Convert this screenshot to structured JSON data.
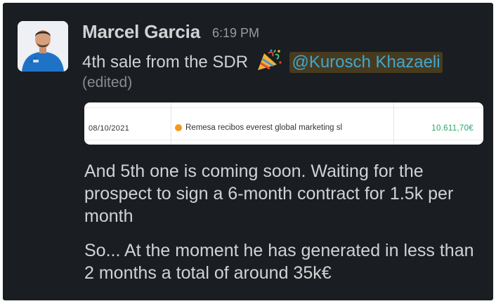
{
  "message": {
    "author": "Marcel Garcia",
    "time": "6:19 PM",
    "text_prefix": "4th sale from the SDR",
    "emoji": "party-popper-icon",
    "mention": "@Kurosch Khazaeli",
    "edited": "(edited)"
  },
  "attachment": {
    "date": "08/10/2021",
    "description": "Remesa recibos everest global marketing sl",
    "amount": "10.611,70€",
    "status_color": "#f29a1c",
    "amount_color": "#2aa56a"
  },
  "followups": [
    "And 5th one is coming soon. Waiting for the prospect to sign a 6-month contract for 1.5k per month",
    "So... At the moment he has generated in less than 2 months a total of around 35k€"
  ],
  "colors": {
    "background": "#1a1d21",
    "text": "#d1d2d3",
    "mention_bg": "#473b1f",
    "mention_text": "#3fa7d3"
  }
}
